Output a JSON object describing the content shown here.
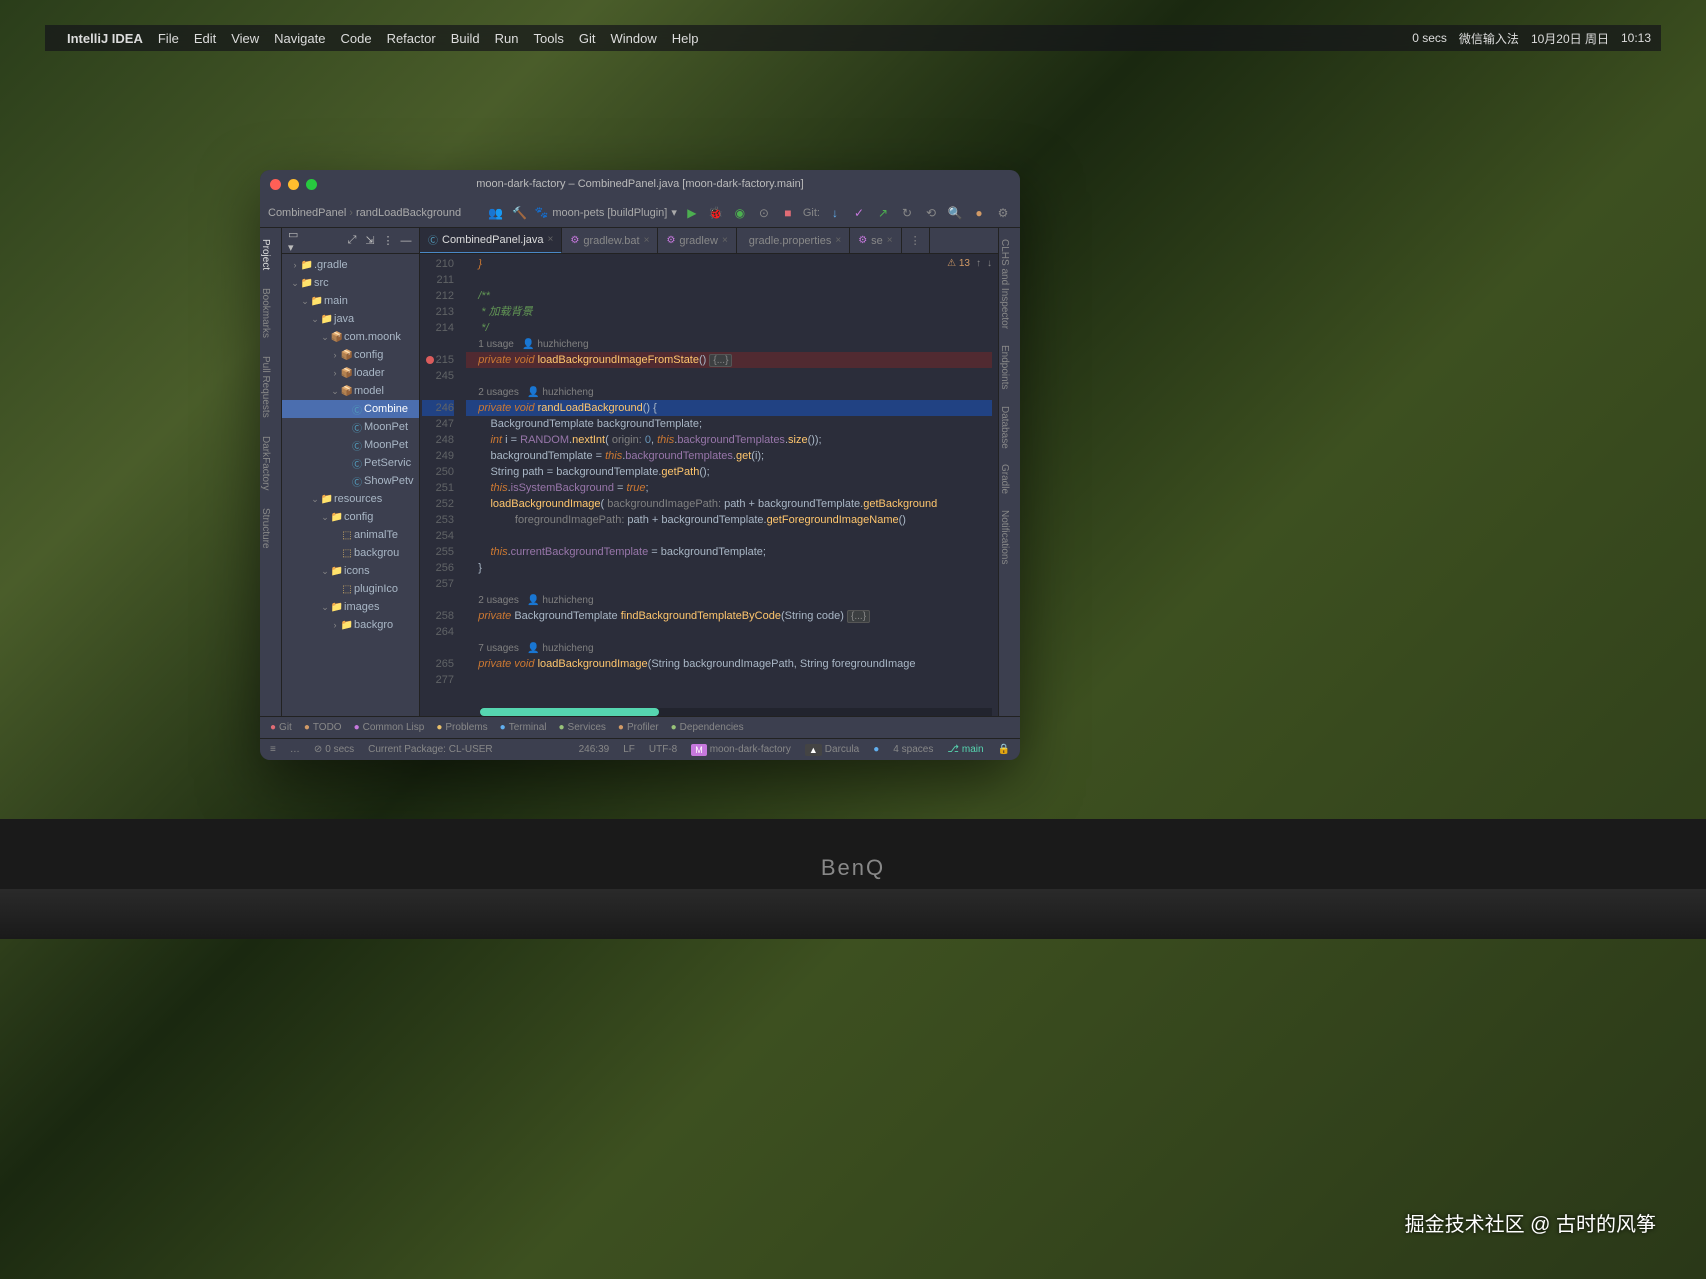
{
  "menubar": {
    "app": "IntelliJ IDEA",
    "items": [
      "File",
      "Edit",
      "View",
      "Navigate",
      "Code",
      "Refactor",
      "Build",
      "Run",
      "Tools",
      "Git",
      "Window",
      "Help"
    ],
    "status": {
      "secs": "0 secs",
      "ime": "微信输入法",
      "date": "10月20日 周日",
      "time": "10:13"
    }
  },
  "ide": {
    "title": "moon-dark-factory – CombinedPanel.java [moon-dark-factory.main]",
    "breadcrumb": {
      "a": "CombinedPanel",
      "b": "randLoadBackground"
    },
    "runconfig": "moon-pets [buildPlugin]",
    "gitlabel": "Git:",
    "leftbar": [
      "Project",
      "Bookmarks",
      "Pull Requests",
      "DarkFactory",
      "Structure"
    ],
    "rightbar": [
      "CLHS and Inspector",
      "Endpoints",
      "Database",
      "Gradle",
      "Notifications"
    ],
    "tree": [
      {
        "d": 1,
        "arrow": "›",
        "icon": "folder",
        "label": ".gradle"
      },
      {
        "d": 1,
        "arrow": "⌄",
        "icon": "folder",
        "label": "src"
      },
      {
        "d": 2,
        "arrow": "⌄",
        "icon": "folder",
        "label": "main"
      },
      {
        "d": 3,
        "arrow": "⌄",
        "icon": "folder",
        "label": "java"
      },
      {
        "d": 4,
        "arrow": "⌄",
        "icon": "pkg",
        "label": "com.moonk"
      },
      {
        "d": 5,
        "arrow": "›",
        "icon": "pkg",
        "label": "config"
      },
      {
        "d": 5,
        "arrow": "›",
        "icon": "pkg",
        "label": "loader"
      },
      {
        "d": 5,
        "arrow": "⌄",
        "icon": "pkg",
        "label": "model"
      },
      {
        "d": 6,
        "arrow": "",
        "icon": "cls",
        "label": "Combine",
        "sel": true
      },
      {
        "d": 6,
        "arrow": "",
        "icon": "cls",
        "label": "MoonPet"
      },
      {
        "d": 6,
        "arrow": "",
        "icon": "cls",
        "label": "MoonPet"
      },
      {
        "d": 6,
        "arrow": "",
        "icon": "cls",
        "label": "PetServic"
      },
      {
        "d": 6,
        "arrow": "",
        "icon": "cls",
        "label": "ShowPetv"
      },
      {
        "d": 3,
        "arrow": "⌄",
        "icon": "folder",
        "label": "resources"
      },
      {
        "d": 4,
        "arrow": "⌄",
        "icon": "folder",
        "label": "config"
      },
      {
        "d": 5,
        "arrow": "",
        "icon": "xml",
        "label": "animalTe"
      },
      {
        "d": 5,
        "arrow": "",
        "icon": "xml",
        "label": "backgrou"
      },
      {
        "d": 4,
        "arrow": "⌄",
        "icon": "folder",
        "label": "icons"
      },
      {
        "d": 5,
        "arrow": "",
        "icon": "xml",
        "label": "pluginIco"
      },
      {
        "d": 4,
        "arrow": "⌄",
        "icon": "folder",
        "label": "images"
      },
      {
        "d": 5,
        "arrow": "›",
        "icon": "folder",
        "label": "backgro"
      }
    ],
    "tabs": [
      {
        "icon": "java",
        "label": "CombinedPanel.java",
        "active": true
      },
      {
        "icon": "bat",
        "label": "gradlew.bat"
      },
      {
        "icon": "bat",
        "label": "gradlew"
      },
      {
        "icon": "prop",
        "label": "gradle.properties"
      },
      {
        "icon": "bat",
        "label": "se"
      }
    ],
    "warnings": "13",
    "bottomtabs": [
      {
        "cls": "bt-git",
        "label": "Git"
      },
      {
        "cls": "bt-todo",
        "label": "TODO"
      },
      {
        "cls": "bt-lisp",
        "label": "Common Lisp"
      },
      {
        "cls": "bt-prob",
        "label": "Problems"
      },
      {
        "cls": "bt-term",
        "label": "Terminal"
      },
      {
        "cls": "bt-serv",
        "label": "Services"
      },
      {
        "cls": "bt-prof",
        "label": "Profiler"
      },
      {
        "cls": "bt-dep",
        "label": "Dependencies"
      }
    ],
    "status": {
      "secs": "0 secs",
      "package": "Current Package: CL-USER",
      "pos": "246:39",
      "sep": "LF",
      "enc": "UTF-8",
      "module": "M",
      "modname": "moon-dark-factory",
      "theme": "Darcula",
      "spaces": "4 spaces",
      "branch": "main"
    },
    "code": {
      "lines": [
        {
          "n": "210",
          "html": "    <span class='kw'>}</span>"
        },
        {
          "n": "211",
          "html": ""
        },
        {
          "n": "212",
          "html": "    <span class='cmt'>/**</span>"
        },
        {
          "n": "213",
          "html": "    <span class='cmt'> * 加载背景</span>"
        },
        {
          "n": "214",
          "html": "    <span class='cmt'> */</span>"
        },
        {
          "n": "",
          "html": "    <span class='usage'>1 usage   👤 huzhicheng</span>"
        },
        {
          "n": "215",
          "bp": true,
          "cls": "hl-red",
          "html": "    <span class='kw'>private void</span> <span class='fn'>loadBackgroundImageFromState</span>() <span class='fold'>{...}</span>"
        },
        {
          "n": "245",
          "html": ""
        },
        {
          "n": "",
          "html": "    <span class='usage'>2 usages   👤 huzhicheng</span>"
        },
        {
          "n": "246",
          "cls": "hl",
          "html": "    <span class='kw'>private void</span> <span class='fn'>randLoadBackground</span>() {"
        },
        {
          "n": "247",
          "html": "        <span class='typ'>BackgroundTemplate</span> backgroundTemplate;"
        },
        {
          "n": "248",
          "html": "        <span class='kw'>int</span> i = <span class='id'>RANDOM</span>.<span class='fn'>nextInt</span>( <span class='param'>origin:</span> <span class='num'>0</span>, <span class='kw'>this</span>.<span class='id'>backgroundTemplates</span>.<span class='fn'>size</span>());"
        },
        {
          "n": "249",
          "html": "        backgroundTemplate = <span class='kw'>this</span>.<span class='id'>backgroundTemplates</span>.<span class='fn'>get</span>(i);"
        },
        {
          "n": "250",
          "html": "        <span class='typ'>String</span> path = backgroundTemplate.<span class='fn'>getPath</span>();"
        },
        {
          "n": "251",
          "html": "        <span class='kw'>this</span>.<span class='id'>isSystemBackground</span> = <span class='kw'>true</span>;"
        },
        {
          "n": "252",
          "html": "        <span class='fn'>loadBackgroundImage</span>( <span class='param'>backgroundImagePath:</span> path + backgroundTemplate.<span class='fn'>getBackground</span>"
        },
        {
          "n": "253",
          "html": "                <span class='param'>foregroundImagePath:</span> path + backgroundTemplate.<span class='fn'>getForegroundImageName</span>()"
        },
        {
          "n": "254",
          "html": ""
        },
        {
          "n": "255",
          "html": "        <span class='kw'>this</span>.<span class='id'>currentBackgroundTemplate</span> = backgroundTemplate;"
        },
        {
          "n": "256",
          "html": "    }"
        },
        {
          "n": "257",
          "html": ""
        },
        {
          "n": "",
          "html": "    <span class='usage'>2 usages   👤 huzhicheng</span>"
        },
        {
          "n": "258",
          "html": "    <span class='kw'>private</span> <span class='typ'>BackgroundTemplate</span> <span class='fn'>findBackgroundTemplateByCode</span>(<span class='typ'>String</span> code) <span class='fold'>{...}</span>"
        },
        {
          "n": "264",
          "html": ""
        },
        {
          "n": "",
          "html": "    <span class='usage'>7 usages   👤 huzhicheng</span>"
        },
        {
          "n": "265",
          "html": "    <span class='kw'>private void</span> <span class='fn'>loadBackgroundImage</span>(<span class='typ'>String</span> backgroundImagePath, <span class='typ'>String</span> foregroundImage"
        },
        {
          "n": "277",
          "html": ""
        }
      ]
    }
  },
  "monitor": {
    "brand": "BenQ"
  },
  "watermark": "掘金技术社区 @ 古时的风筝"
}
